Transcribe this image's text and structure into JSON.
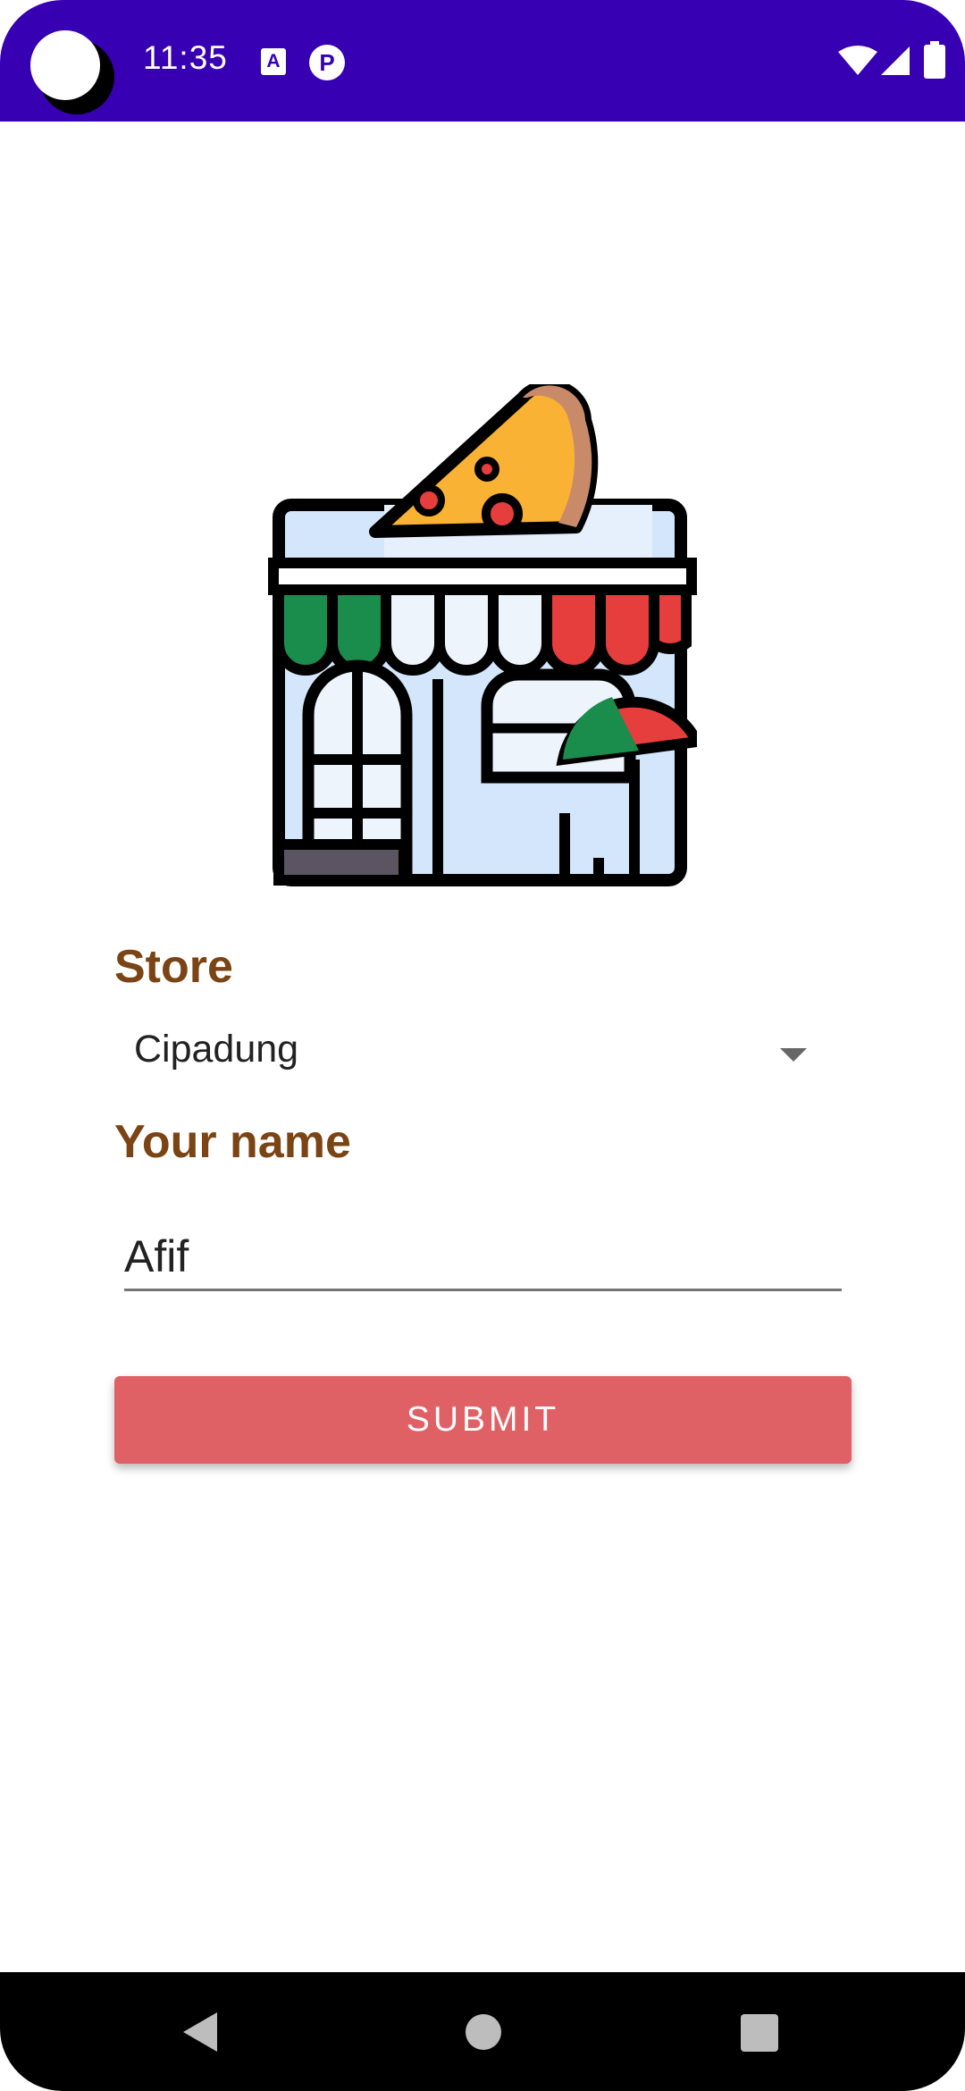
{
  "status_bar": {
    "time": "11:35",
    "icons": [
      "camera-cutout-icon",
      "a-notification-icon",
      "p-notification-icon",
      "wifi-icon",
      "signal-icon",
      "battery-icon"
    ],
    "color": "#3700b3"
  },
  "logo": {
    "icon": "pizza-store-icon"
  },
  "form": {
    "store_label": "Store",
    "store_value": "Cipadung",
    "name_label": "Your name",
    "name_value": "Afif",
    "submit_label": "SUBMIT"
  },
  "colors": {
    "label": "#7a4414",
    "button": "#e06165"
  },
  "nav_bar": {
    "icons": [
      "back-icon",
      "home-icon",
      "recents-icon"
    ]
  }
}
